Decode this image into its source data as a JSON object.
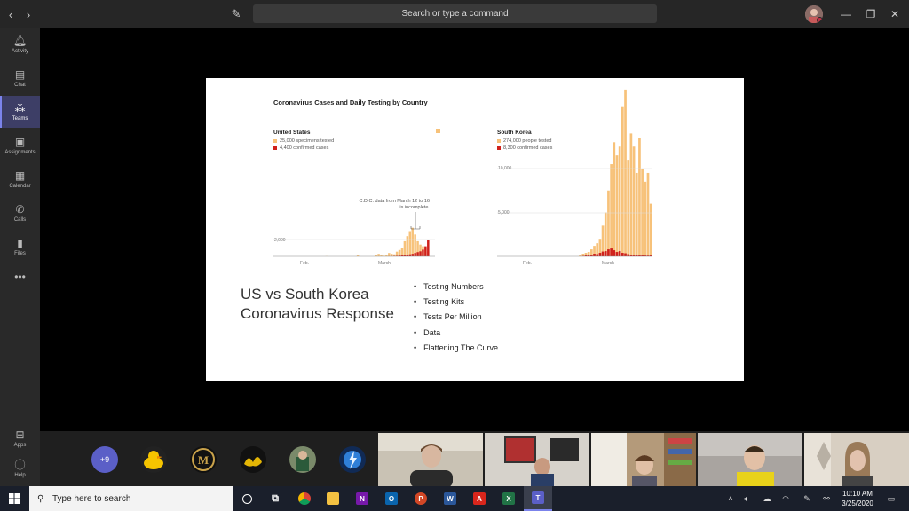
{
  "titlebar": {
    "search_placeholder": "Search or type a command",
    "back_icon": "chevron-left-icon",
    "forward_icon": "chevron-right-icon",
    "compose_icon": "compose-icon"
  },
  "rail": {
    "items": [
      {
        "label": "Activity",
        "icon": "bell-icon"
      },
      {
        "label": "Chat",
        "icon": "chat-icon"
      },
      {
        "label": "Teams",
        "icon": "teams-icon",
        "active": true
      },
      {
        "label": "Assignments",
        "icon": "assignments-icon"
      },
      {
        "label": "Calendar",
        "icon": "calendar-icon"
      },
      {
        "label": "Calls",
        "icon": "phone-icon"
      },
      {
        "label": "Files",
        "icon": "files-icon"
      }
    ],
    "bottom": [
      {
        "label": "Apps",
        "icon": "apps-icon"
      },
      {
        "label": "Help",
        "icon": "help-icon"
      }
    ],
    "accent": "#7b83eb"
  },
  "slide": {
    "chart_title": "Coronavirus Cases and Daily Testing by Country",
    "us": {
      "title": "United States",
      "tested": "25,000 specimens tested",
      "confirmed": "4,400 confirmed cases",
      "annotation": "C.D.C. data from March 12 to 16 is incomplete.",
      "ytick": "2,000",
      "xticks": [
        "Feb.",
        "March"
      ]
    },
    "korea": {
      "title": "South Korea",
      "tested": "274,000 people tested",
      "confirmed": "8,300 confirmed cases",
      "yticks": [
        "10,000",
        "5,000"
      ],
      "xticks": [
        "Feb.",
        "March"
      ]
    },
    "heading": "US vs South Korea Coronavirus Response",
    "bullets": [
      "Testing Numbers",
      "Testing Kits",
      "Tests Per Million",
      "Data",
      "Flattening The Curve"
    ],
    "colors": {
      "tested": "#f7c27a",
      "confirmed": "#d0211b"
    }
  },
  "chart_data": [
    {
      "type": "bar",
      "title": "United States",
      "series": [
        {
          "name": "25,000 specimens tested",
          "values": [
            0,
            0,
            0,
            0,
            0,
            0,
            0,
            0,
            0,
            0,
            0,
            0,
            0,
            0,
            0,
            0,
            0,
            0,
            0,
            0,
            10,
            0,
            0,
            0,
            0,
            0,
            0,
            0,
            0,
            0,
            0,
            0,
            50,
            0,
            0,
            0,
            0,
            0,
            0,
            80,
            150,
            100,
            30,
            60,
            200,
            150,
            120,
            280,
            380,
            520,
            900,
            1200,
            1500,
            1700,
            1300,
            900,
            700,
            600,
            500,
            300
          ]
        },
        {
          "name": "4,400 confirmed cases",
          "values": [
            0,
            0,
            0,
            0,
            0,
            0,
            0,
            0,
            0,
            0,
            0,
            0,
            0,
            0,
            0,
            0,
            0,
            0,
            0,
            0,
            0,
            0,
            0,
            0,
            0,
            0,
            0,
            0,
            0,
            0,
            0,
            0,
            0,
            0,
            0,
            0,
            0,
            0,
            0,
            0,
            0,
            0,
            0,
            0,
            5,
            10,
            20,
            30,
            40,
            60,
            80,
            100,
            120,
            150,
            200,
            250,
            300,
            400,
            600,
            1000
          ]
        }
      ],
      "ylim": [
        0,
        3000
      ]
    },
    {
      "type": "bar",
      "title": "South Korea",
      "series": [
        {
          "name": "274,000 people tested",
          "values": [
            0,
            0,
            0,
            0,
            0,
            0,
            0,
            0,
            0,
            0,
            0,
            0,
            0,
            0,
            0,
            0,
            0,
            0,
            0,
            0,
            0,
            0,
            0,
            0,
            0,
            0,
            0,
            0,
            0,
            200,
            300,
            400,
            500,
            800,
            1200,
            1500,
            2000,
            3500,
            5000,
            7500,
            10500,
            13000,
            11500,
            12500,
            17000,
            19000,
            11000,
            14000,
            12500,
            9500,
            13500,
            10000,
            8500,
            9500,
            6000
          ]
        },
        {
          "name": "8,300 confirmed cases",
          "values": [
            0,
            0,
            0,
            0,
            0,
            0,
            0,
            0,
            0,
            0,
            0,
            0,
            0,
            0,
            0,
            0,
            0,
            0,
            0,
            0,
            0,
            0,
            0,
            0,
            0,
            0,
            0,
            0,
            0,
            0,
            50,
            100,
            150,
            200,
            300,
            250,
            400,
            550,
            600,
            800,
            900,
            700,
            500,
            600,
            400,
            350,
            250,
            200,
            150,
            180,
            120,
            100,
            90,
            80,
            100
          ]
        }
      ],
      "ylim": [
        0,
        20000
      ]
    }
  ],
  "participants": {
    "overflow": "+9",
    "avatars": [
      "duck-avatar",
      "mustang-avatar",
      "phoenix-avatar",
      "jersey-avatar",
      "lightning-avatar"
    ],
    "videos": [
      "video-participant-1",
      "video-participant-2",
      "video-participant-3",
      "video-participant-4",
      "video-participant-5"
    ]
  },
  "taskbar": {
    "search_placeholder": "Type here to search",
    "time": "10:10 AM",
    "date": "3/25/2020",
    "apps": [
      "chrome",
      "file-explorer",
      "onenote",
      "outlook",
      "powerpoint",
      "word",
      "acrobat",
      "excel",
      "teams"
    ]
  }
}
